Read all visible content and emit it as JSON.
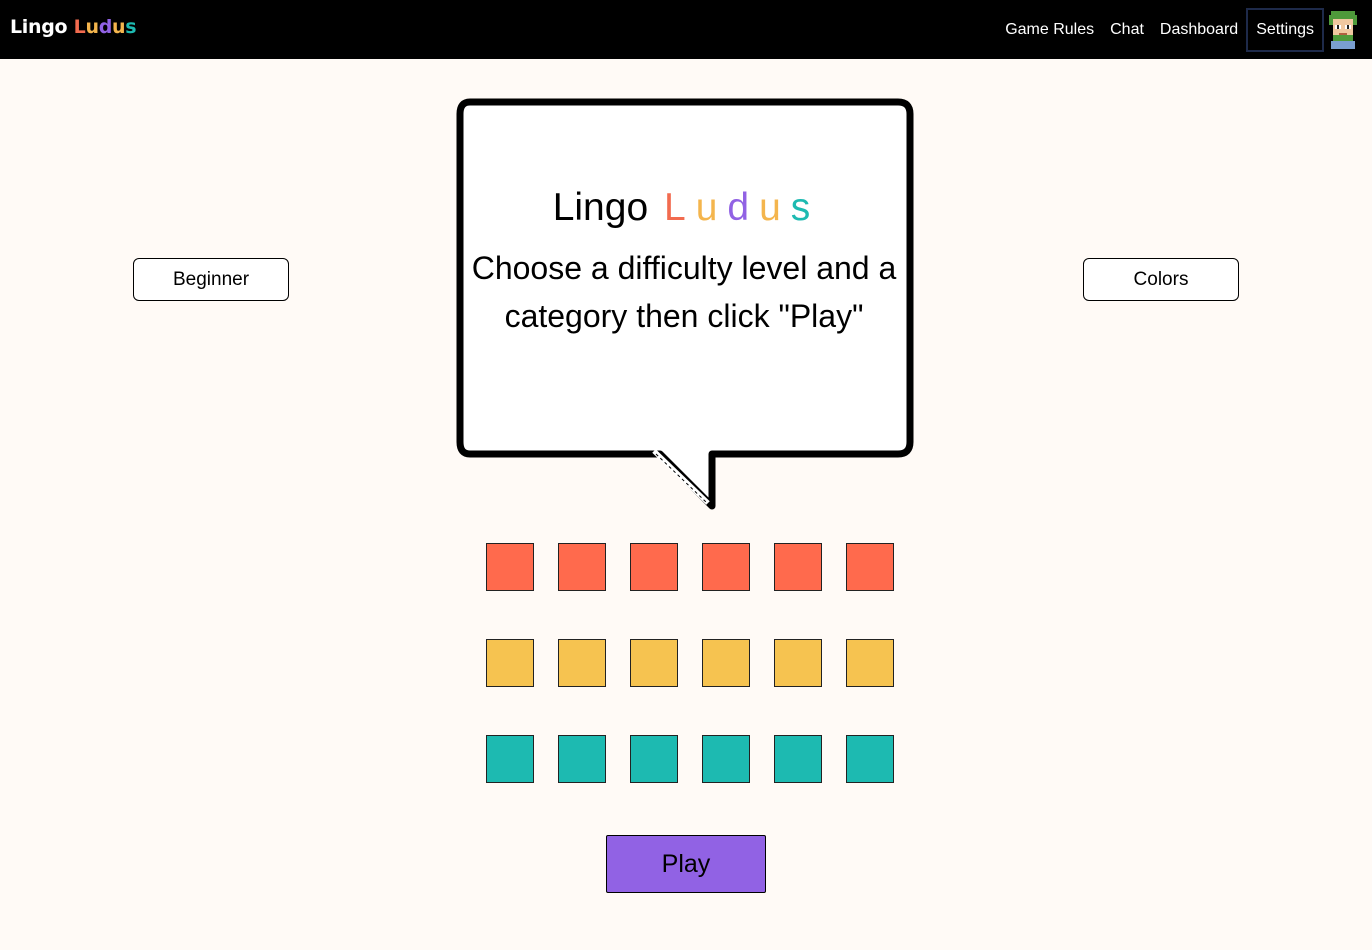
{
  "navbar": {
    "brand_prefix": "Lingo",
    "brand_ludus": [
      "L",
      "u",
      "d",
      "u",
      "s"
    ],
    "links": [
      "Game Rules",
      "Chat",
      "Dashboard",
      "Settings"
    ],
    "avatar_icon": "pixel-avatar-icon"
  },
  "colors": {
    "ludus_letters": [
      "#f26b4f",
      "#f4b54d",
      "#9162e4",
      "#f4b54d",
      "#1dbab1"
    ],
    "tile_rows": [
      "#ff6a4d",
      "#f6c350",
      "#1dbab1"
    ],
    "play": "#9162e4",
    "background": "#fffaf6"
  },
  "selectors": {
    "difficulty": "Beginner",
    "category": "Colors"
  },
  "bubble": {
    "title_prefix": "Lingo",
    "title_ludus": [
      "L",
      "u",
      "d",
      "u",
      "s"
    ],
    "message_line1": "Choose a difficulty level and a",
    "message_line2": "category then click \"Play\""
  },
  "grid": {
    "rows": 3,
    "columns": 6
  },
  "play_button": {
    "label": "Play"
  }
}
